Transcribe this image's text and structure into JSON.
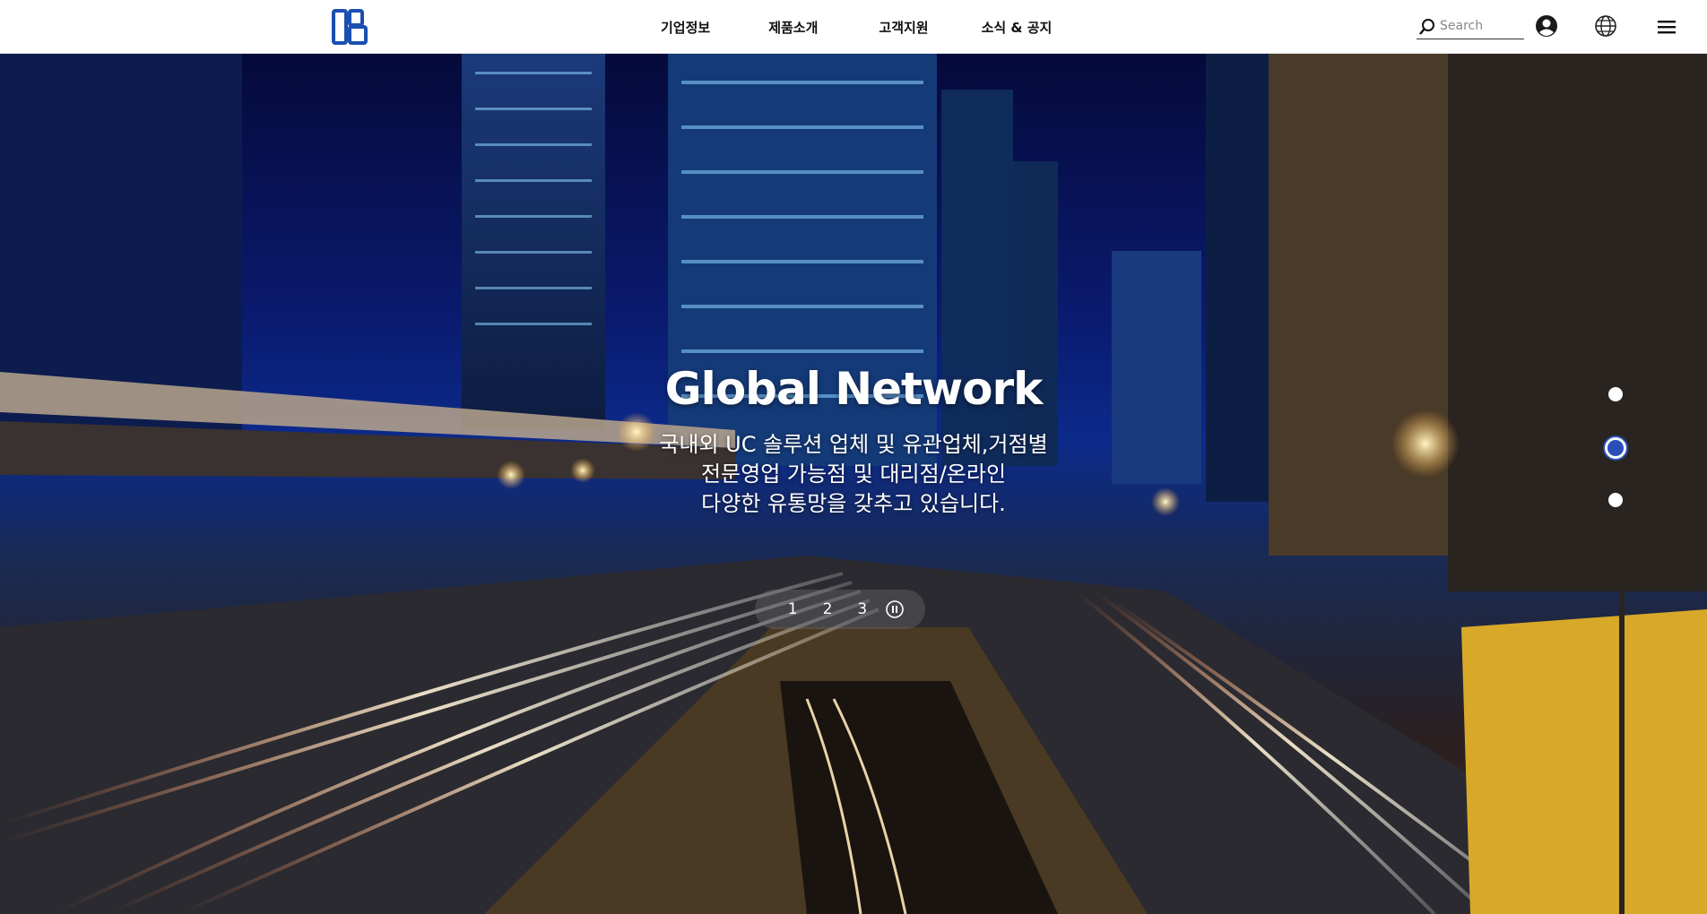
{
  "header": {
    "logo_name": "logo",
    "nav": [
      "기업정보",
      "제품소개",
      "고객지원",
      "소식 & 공지"
    ],
    "search_placeholder": "Search"
  },
  "hero": {
    "title": "Global Network",
    "subtitle_lines": [
      "국내외 UC 솔루션 업체 및 유관업체,거점별",
      "전문영업 가능점 및 대리점/온라인",
      "다양한 유통망을 갖추고 있습니다."
    ],
    "pager": [
      "1",
      "2",
      "3"
    ],
    "active_dot": 2
  },
  "colors": {
    "accent": "#2b4fb8",
    "logo": "#1a4fb0"
  }
}
